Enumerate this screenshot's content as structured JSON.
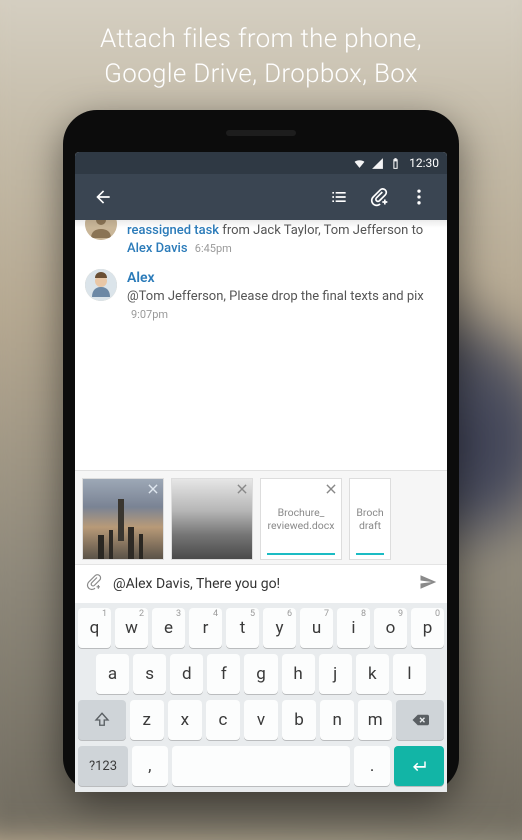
{
  "promo": {
    "line1": "Attach files from the phone,",
    "line2": "Google Drive, Dropbox, Box"
  },
  "status_bar": {
    "time": "12:30"
  },
  "activity": {
    "item1": {
      "highlight": "reassigned task",
      "mid": " from Jack Taylor, Tom Jefferson to ",
      "target": "Alex Davis",
      "time": "6:45pm"
    },
    "item2": {
      "name": "Alex",
      "text": "@Tom Jefferson, Please drop the final texts and pix",
      "time": "9:07pm"
    }
  },
  "attachments": {
    "doc1": "Brochure_\nreviewed.docx",
    "doc2": "Broch\ndraft"
  },
  "compose": {
    "text": "@Alex Davis, There you go!"
  },
  "keyboard": {
    "row1": [
      {
        "k": "q",
        "s": "1"
      },
      {
        "k": "w",
        "s": "2"
      },
      {
        "k": "e",
        "s": "3"
      },
      {
        "k": "r",
        "s": "4"
      },
      {
        "k": "t",
        "s": "5"
      },
      {
        "k": "y",
        "s": "6"
      },
      {
        "k": "u",
        "s": "7"
      },
      {
        "k": "i",
        "s": "8"
      },
      {
        "k": "o",
        "s": "9"
      },
      {
        "k": "p",
        "s": "0"
      }
    ],
    "row2": [
      "a",
      "s",
      "d",
      "f",
      "g",
      "h",
      "j",
      "k",
      "l"
    ],
    "row3": [
      "z",
      "x",
      "c",
      "v",
      "b",
      "n",
      "m"
    ],
    "symkey": "?123",
    "comma": ",",
    "period": "."
  }
}
